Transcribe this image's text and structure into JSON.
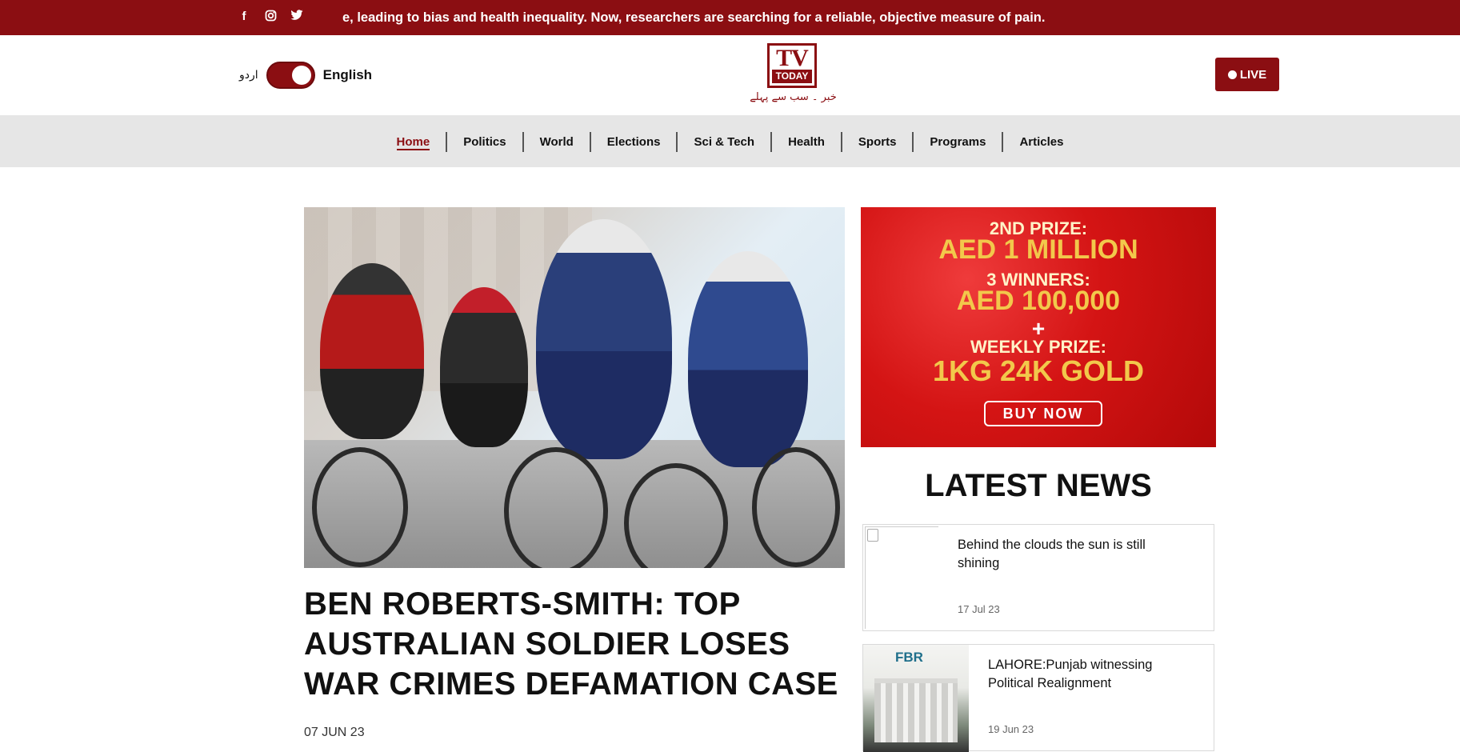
{
  "topbar": {
    "social_icons": [
      "facebook-icon",
      "instagram-icon",
      "twitter-icon"
    ],
    "ticker": "e, leading to bias and health inequality. Now, researchers are searching for a reliable, objective measure of pain."
  },
  "header": {
    "lang_urdu": "اردو",
    "lang_english": "English",
    "logo_tv": "TV",
    "logo_today": "TODAY",
    "logo_tagline": "خبر ۔ سب سے پہلے",
    "live_label": "LIVE"
  },
  "nav": {
    "items": [
      "Home",
      "Politics",
      "World",
      "Elections",
      "Sci & Tech",
      "Health",
      "Sports",
      "Programs",
      "Articles"
    ],
    "active": "Home"
  },
  "feature": {
    "headline": "BEN ROBERTS-SMITH: TOP AUSTRALIAN SOLDIER LOSES WAR CRIMES DEFAMATION CASE",
    "date": "07 JUN 23"
  },
  "ad": {
    "line1": "2ND PRIZE:",
    "line2": "AED 1 MILLION",
    "line3": "3 WINNERS:",
    "line4": "AED 100,000",
    "line5": "+",
    "line6": "WEEKLY PRIZE:",
    "line7": "1KG 24K GOLD",
    "button": "BUY NOW"
  },
  "latest": {
    "title": "LATEST NEWS",
    "items": [
      {
        "title": "Behind the clouds the sun is still shining",
        "date": "17 Jul 23"
      },
      {
        "title": "LAHORE:Punjab witnessing Political Realignment",
        "date": "19 Jun 23",
        "thumb_text": "FBR"
      }
    ]
  },
  "colors": {
    "brand": "#8b0e12",
    "nav_bg": "#e6e6e6"
  }
}
